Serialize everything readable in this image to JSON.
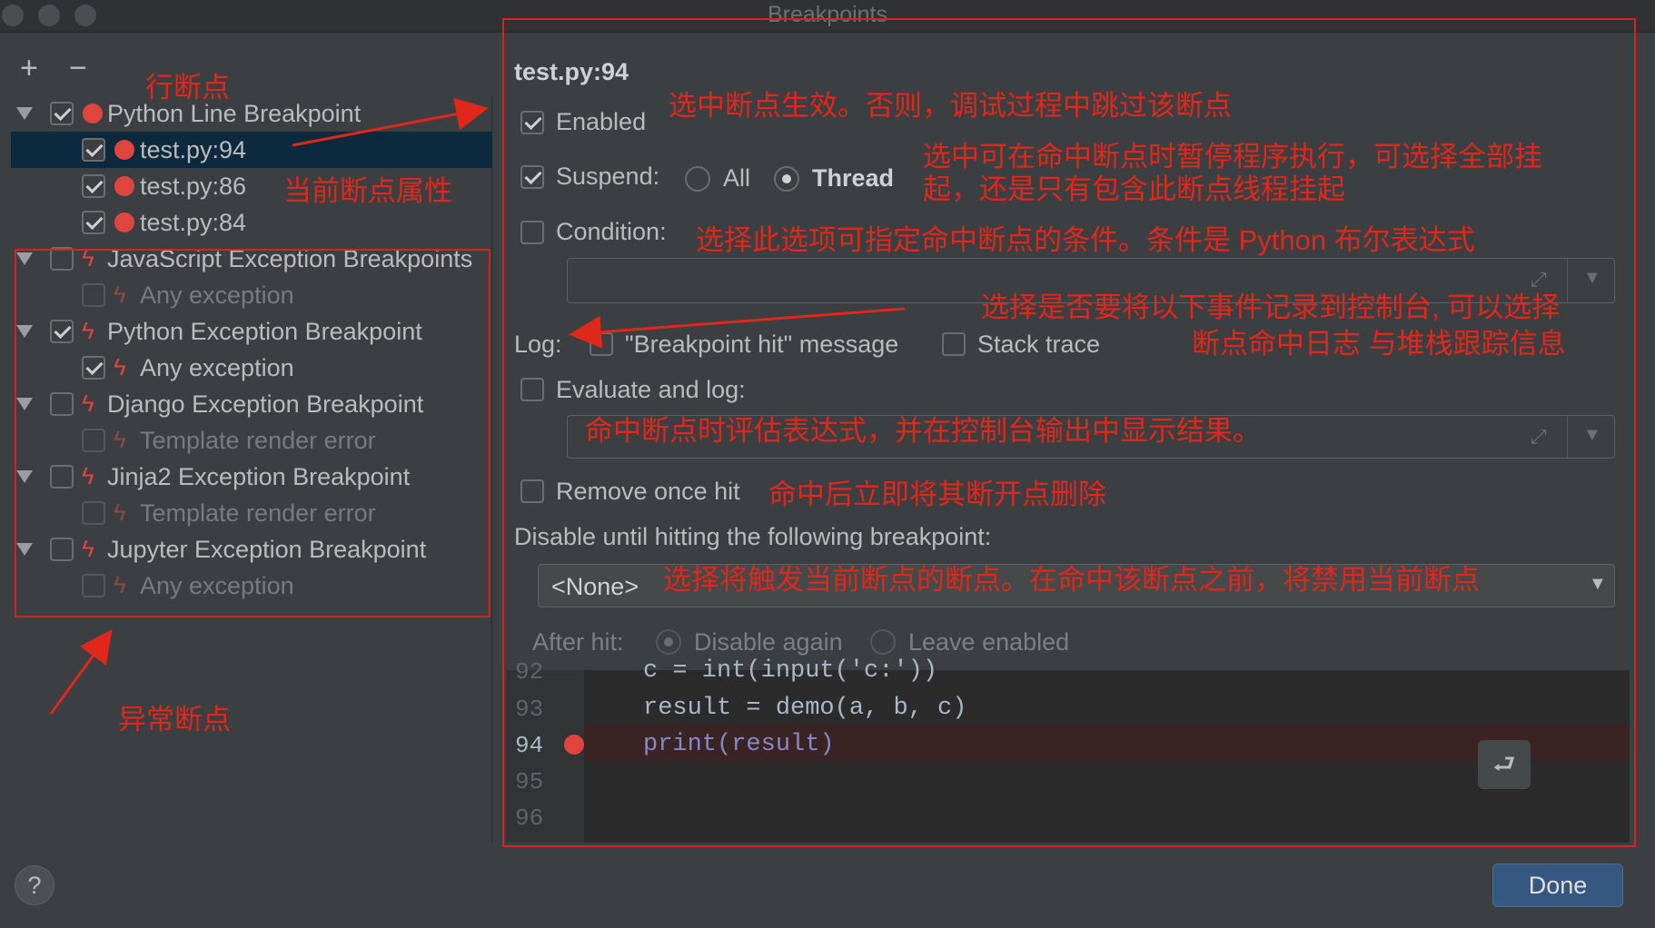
{
  "window": {
    "title": "Breakpoints"
  },
  "toolbar": {
    "add": "+",
    "remove": "−"
  },
  "tree": {
    "items": [
      {
        "label": "Python Line Breakpoint",
        "checked": true,
        "icon": "red-dot-icon"
      },
      {
        "label": "test.py:94",
        "checked": true,
        "icon": "red-dot-icon",
        "selected": true
      },
      {
        "label": "test.py:86",
        "checked": true,
        "icon": "red-dot-icon"
      },
      {
        "label": "test.py:84",
        "checked": true,
        "icon": "red-dot-icon"
      },
      {
        "label": "JavaScript Exception Breakpoints",
        "checked": false,
        "icon": "lightning-icon"
      },
      {
        "label": "Any exception",
        "checked": false,
        "icon": "lightning-icon"
      },
      {
        "label": "Python Exception Breakpoint",
        "checked": true,
        "icon": "lightning-icon"
      },
      {
        "label": "Any exception",
        "checked": true,
        "icon": "lightning-icon"
      },
      {
        "label": "Django Exception Breakpoint",
        "checked": false,
        "icon": "lightning-icon"
      },
      {
        "label": "Template render error",
        "checked": false,
        "icon": "lightning-icon"
      },
      {
        "label": "Jinja2 Exception Breakpoint",
        "checked": false,
        "icon": "lightning-icon"
      },
      {
        "label": "Template render error",
        "checked": false,
        "icon": "lightning-icon"
      },
      {
        "label": "Jupyter Exception Breakpoint",
        "checked": false,
        "icon": "lightning-icon"
      },
      {
        "label": "Any exception",
        "checked": false,
        "icon": "lightning-icon"
      }
    ]
  },
  "detail": {
    "title": "test.py:94",
    "enabled": "Enabled",
    "suspend": "Suspend:",
    "suspend_all": "All",
    "suspend_thread": "Thread",
    "condition": "Condition:",
    "log": "Log:",
    "log_message": "\"Breakpoint hit\" message",
    "log_stack": "Stack trace",
    "evaluate": "Evaluate and log:",
    "remove_once": "Remove once hit",
    "disable_until": "Disable until hitting the following breakpoint:",
    "none_option": "<None>",
    "after_hit": "After hit:",
    "disable_again": "Disable again",
    "leave_enabled": "Leave enabled"
  },
  "code": {
    "lines": [
      {
        "num": "92",
        "text": "c = int(input('c:'))"
      },
      {
        "num": "93",
        "text": "result = demo(a, b, c)"
      },
      {
        "num": "94",
        "text": "print(result)"
      },
      {
        "num": "95",
        "text": ""
      },
      {
        "num": "96",
        "text": ""
      }
    ]
  },
  "annotations": {
    "line_bp": "行断点",
    "current_props": "当前断点属性",
    "exception_bp": "异常断点",
    "enabled_note": "选中断点生效。否则，调试过程中跳过该断点",
    "suspend_note_1": "选中可在命中断点时暂停程序执行，可选择全部挂",
    "suspend_note_2": "起，还是只有包含此断点线程挂起",
    "condition_note": "选择此选项可指定命中断点的条件。条件是 Python 布尔表达式",
    "log_note_1": "选择是否要将以下事件记录到控制台, 可以选择",
    "log_note_2": "断点命中日志 与堆栈跟踪信息",
    "evaluate_note": "命中断点时评估表达式，并在控制台输出中显示结果。",
    "remove_note": "命中后立即将其断开点删除",
    "disable_note": "选择将触发当前断点的断点。在命中该断点之前，将禁用当前断点"
  },
  "footer": {
    "done": "Done",
    "help": "?"
  },
  "colors": {
    "annotation": "#e0271b",
    "accent": "#365880",
    "breakpoint": "#e0443e"
  }
}
